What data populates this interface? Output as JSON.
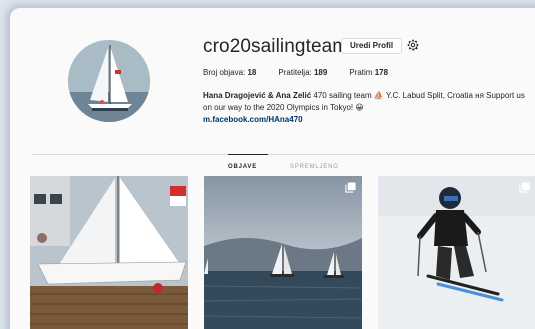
{
  "profile": {
    "username": "cro20sailingteam",
    "edit_label": "Uredi Profil",
    "stats": [
      {
        "label": "Broj objava:",
        "value": "18"
      },
      {
        "label": "Pratitelja:",
        "value": "189"
      },
      {
        "label": "Pratim",
        "value": "178"
      }
    ],
    "bio_name": "Hana Dragojević & Ana Zelić",
    "bio_text": " 470 sailing team ⛵ Y.C. Labud Split, Croatia ня Support us on our way to the 2020 Olympics in Tokyo! 😀",
    "bio_link": "m.facebook.com/HAna470"
  },
  "tabs": [
    {
      "label": "OBJAVE",
      "active": true
    },
    {
      "label": "SPREMLJENO",
      "active": false
    }
  ],
  "icons": {
    "settings": "gear-icon",
    "multi_post": "multiple-photos-icon"
  },
  "colors": {
    "link": "#003569",
    "border": "#dbdbdb",
    "background": "#fafafa"
  }
}
